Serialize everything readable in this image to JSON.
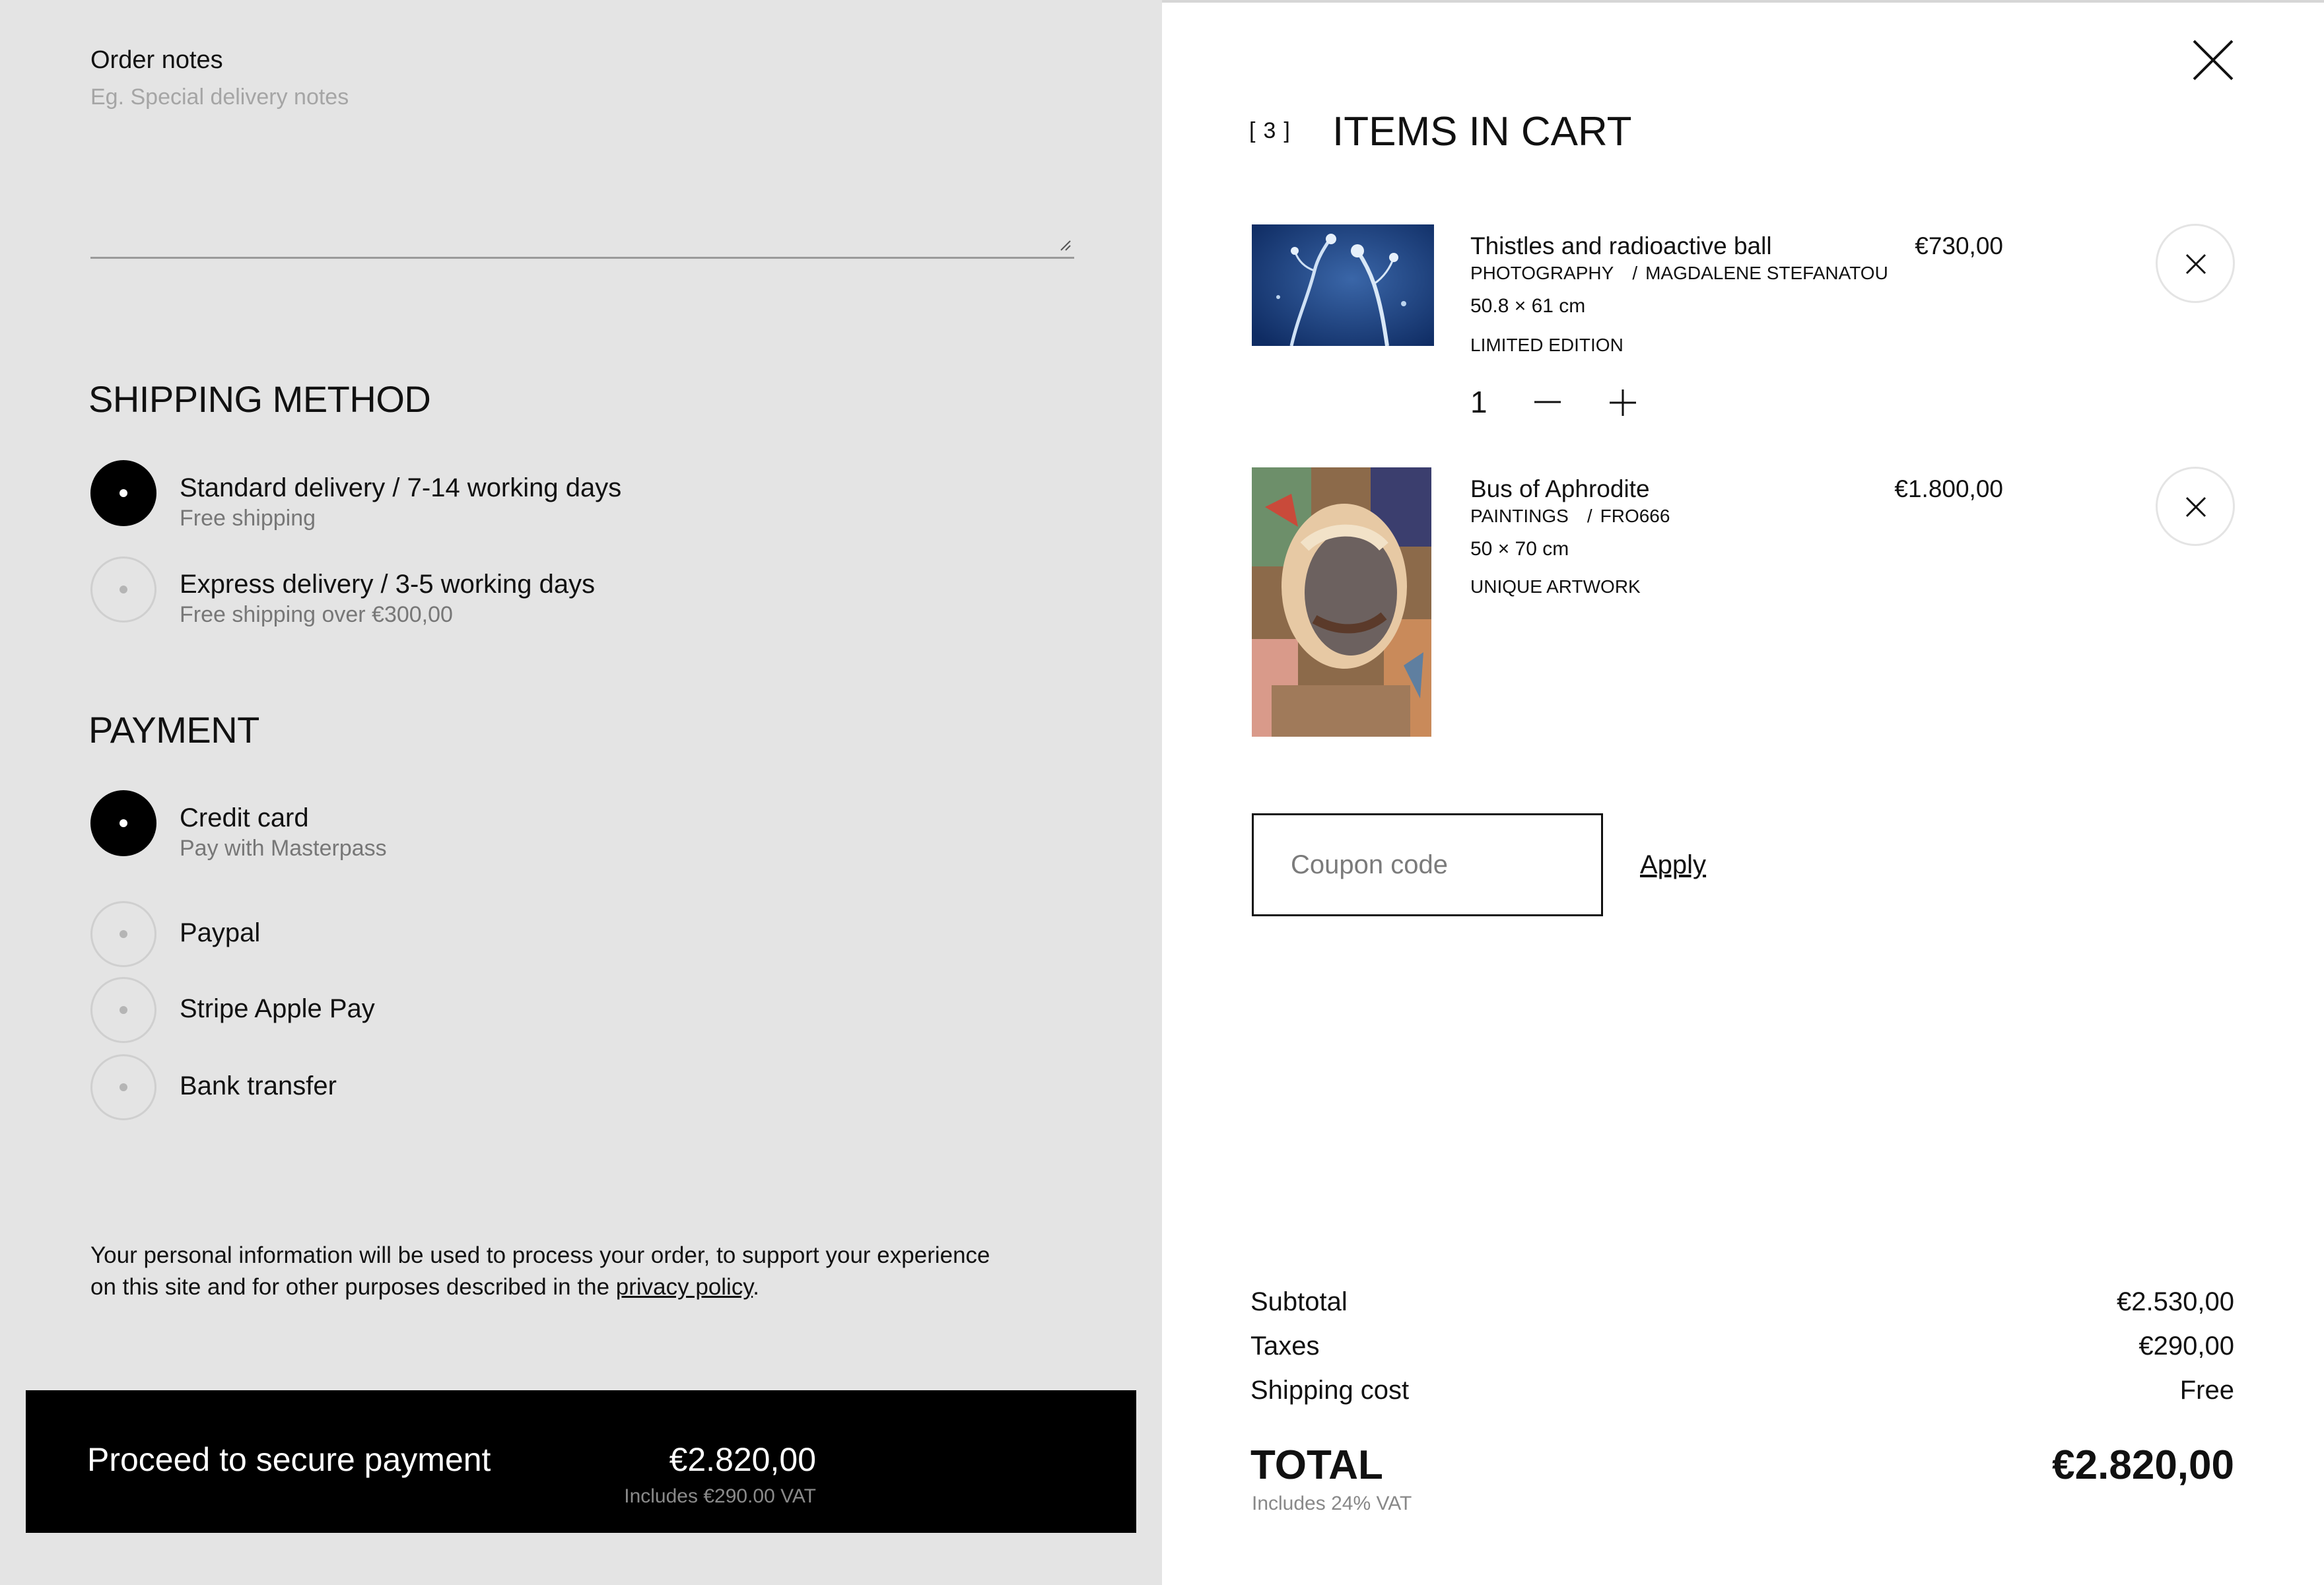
{
  "order_notes": {
    "label": "Order notes",
    "placeholder": "Eg. Special delivery notes"
  },
  "shipping": {
    "title": "SHIPPING METHOD",
    "options": [
      {
        "label": "Standard delivery / 7-14 working days",
        "sub": "Free shipping",
        "selected": true
      },
      {
        "label": "Express delivery / 3-5 working days",
        "sub": "Free shipping over €300,00",
        "selected": false
      }
    ]
  },
  "payment": {
    "title": "PAYMENT",
    "options": [
      {
        "label": "Credit card",
        "sub": "Pay with Masterpass",
        "selected": true
      },
      {
        "label": "Paypal",
        "selected": false
      },
      {
        "label": "Stripe Apple Pay",
        "selected": false
      },
      {
        "label": "Bank transfer",
        "selected": false
      }
    ]
  },
  "privacy": {
    "text": "Your personal information will be used to process your order, to support your experience on this site and for other purposes described in the ",
    "link": "privacy policy",
    "end": "."
  },
  "cta": {
    "label": "Proceed to secure payment",
    "amount": "€2.820,00",
    "vat": "Includes €290.00 VAT"
  },
  "cart": {
    "count": "3",
    "title": "ITEMS IN CART",
    "items": [
      {
        "title": "Thistles and radioactive ball",
        "category": "PHOTOGRAPHY",
        "artist": "MAGDALENE STEFANATOU",
        "dimensions": "50.8 × 61 cm",
        "edition": "LIMITED EDITION",
        "price": "€730,00",
        "quantity": "1"
      },
      {
        "title": "Bus of Aphrodite",
        "category": "PAINTINGS",
        "artist": "FRO666",
        "dimensions": "50 × 70 cm",
        "edition": "UNIQUE ARTWORK",
        "price": "€1.800,00"
      }
    ],
    "coupon_placeholder": "Coupon code",
    "apply_label": "Apply"
  },
  "summary": {
    "subtotal_label": "Subtotal",
    "subtotal_value": "€2.530,00",
    "taxes_label": "Taxes",
    "taxes_value": "€290,00",
    "shipping_label": "Shipping cost",
    "shipping_value": "Free",
    "total_label": "TOTAL",
    "total_value": "€2.820,00",
    "total_vat": "Includes 24% VAT"
  },
  "colors": {
    "left_bg": "#e4e4e4",
    "right_bg": "#ffffff",
    "cta_bg": "#000000",
    "accent": "#000000"
  }
}
